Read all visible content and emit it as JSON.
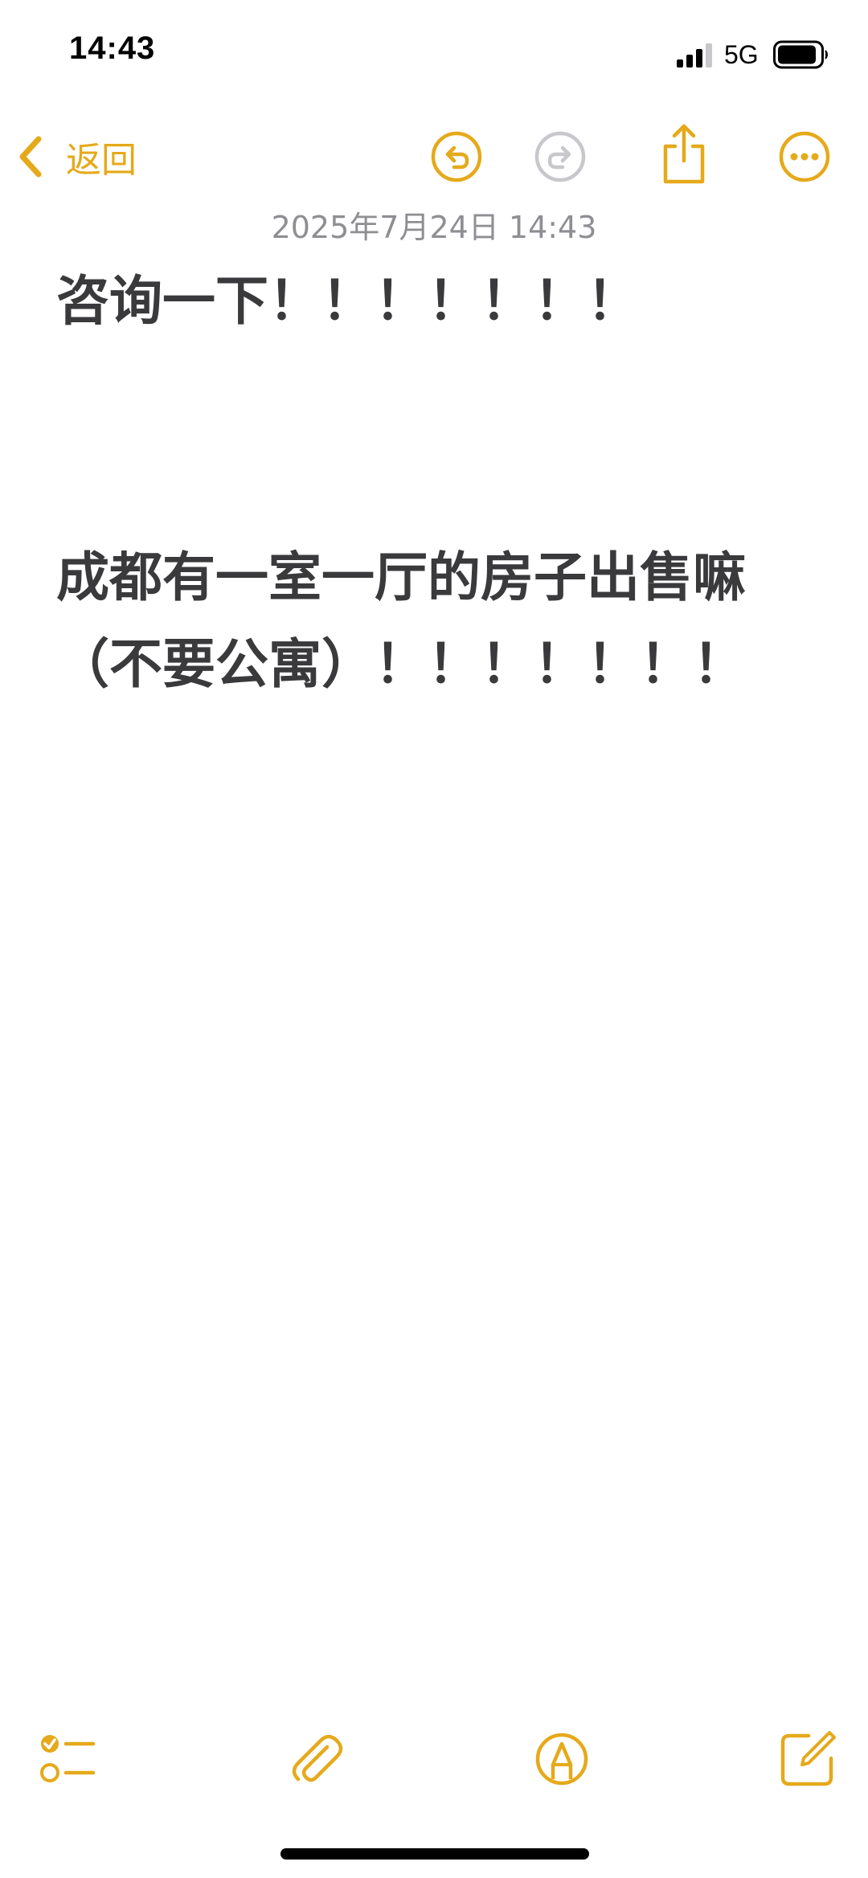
{
  "status_bar": {
    "time": "14:43",
    "network": "5G",
    "icons": [
      "cellular-signal-icon",
      "battery-icon"
    ]
  },
  "nav": {
    "back_label": "返回",
    "icons": [
      "chevron-left-icon",
      "undo-icon",
      "redo-icon",
      "share-icon",
      "more-icon"
    ]
  },
  "note": {
    "date": "2025年7月24日 14:43",
    "title": "咨询一下！！！！！！！",
    "paragraph": "成都有一室一厅的房子出售嘛（不要公寓）！！！！！！！"
  },
  "toolbar": {
    "icons": [
      "checklist-icon",
      "paperclip-icon",
      "markup-pen-icon",
      "compose-icon"
    ]
  },
  "colors": {
    "accent": "#e5a91a",
    "disabled": "#c7c7cc",
    "text": "#3a3a3c",
    "secondary_text": "#8e8e93"
  }
}
